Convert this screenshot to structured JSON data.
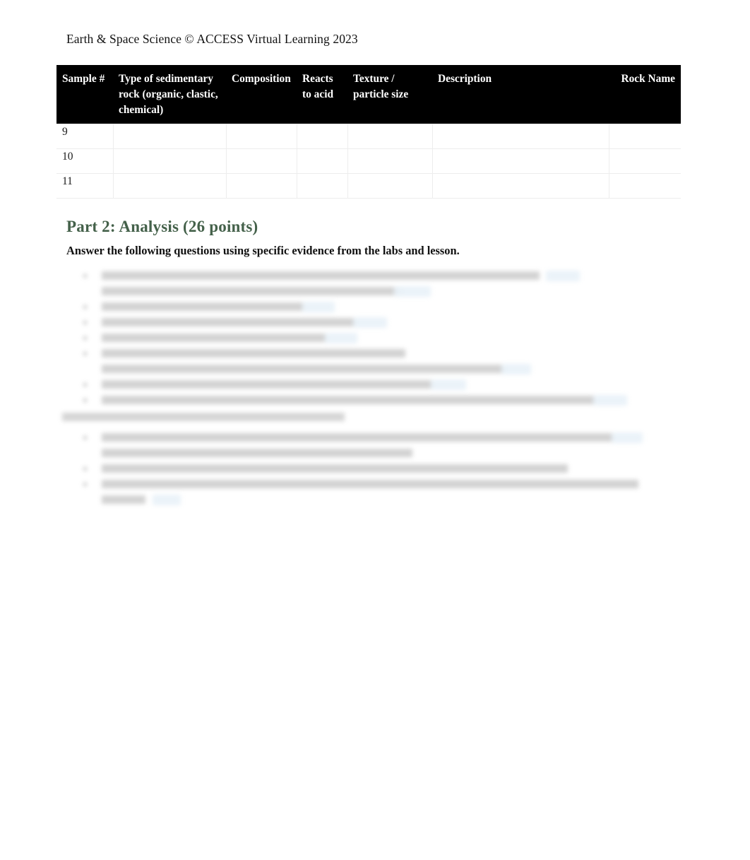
{
  "document": {
    "running_header": "Earth & Space Science © ACCESS Virtual Learning 2023",
    "page_background": "#ffffff"
  },
  "table": {
    "name": "sedimentary-rock-identification-table",
    "header_background": "#000000",
    "header_text_color": "#ffffff",
    "columns": [
      {
        "key": "sample",
        "label": "Sample #"
      },
      {
        "key": "type",
        "label": "Type of sedimentary rock (organic, clastic, chemical)"
      },
      {
        "key": "composition",
        "label": "Composition"
      },
      {
        "key": "acid",
        "label": "Reacts to acid"
      },
      {
        "key": "texture",
        "label": "Texture / particle size"
      },
      {
        "key": "description",
        "label": "Description"
      },
      {
        "key": "rock_name",
        "label": "Rock Name"
      }
    ],
    "rows": [
      {
        "sample": "9",
        "type": "",
        "composition": "",
        "acid": "",
        "texture": "",
        "description": "",
        "rock_name": ""
      },
      {
        "sample": "10",
        "type": "",
        "composition": "",
        "acid": "",
        "texture": "",
        "description": "",
        "rock_name": ""
      },
      {
        "sample": "11",
        "type": "",
        "composition": "",
        "acid": "",
        "texture": "",
        "description": "",
        "rock_name": ""
      }
    ]
  },
  "part2": {
    "heading": "Part 2: Analysis (26 points)",
    "heading_color": "#44614a",
    "instruction": "Answer the following questions using specific evidence from the labs and lesson.",
    "questions_note": "Question text is blurred/redacted in the source image and is not legible.",
    "answer_highlight_color": "#e8f2f8"
  }
}
